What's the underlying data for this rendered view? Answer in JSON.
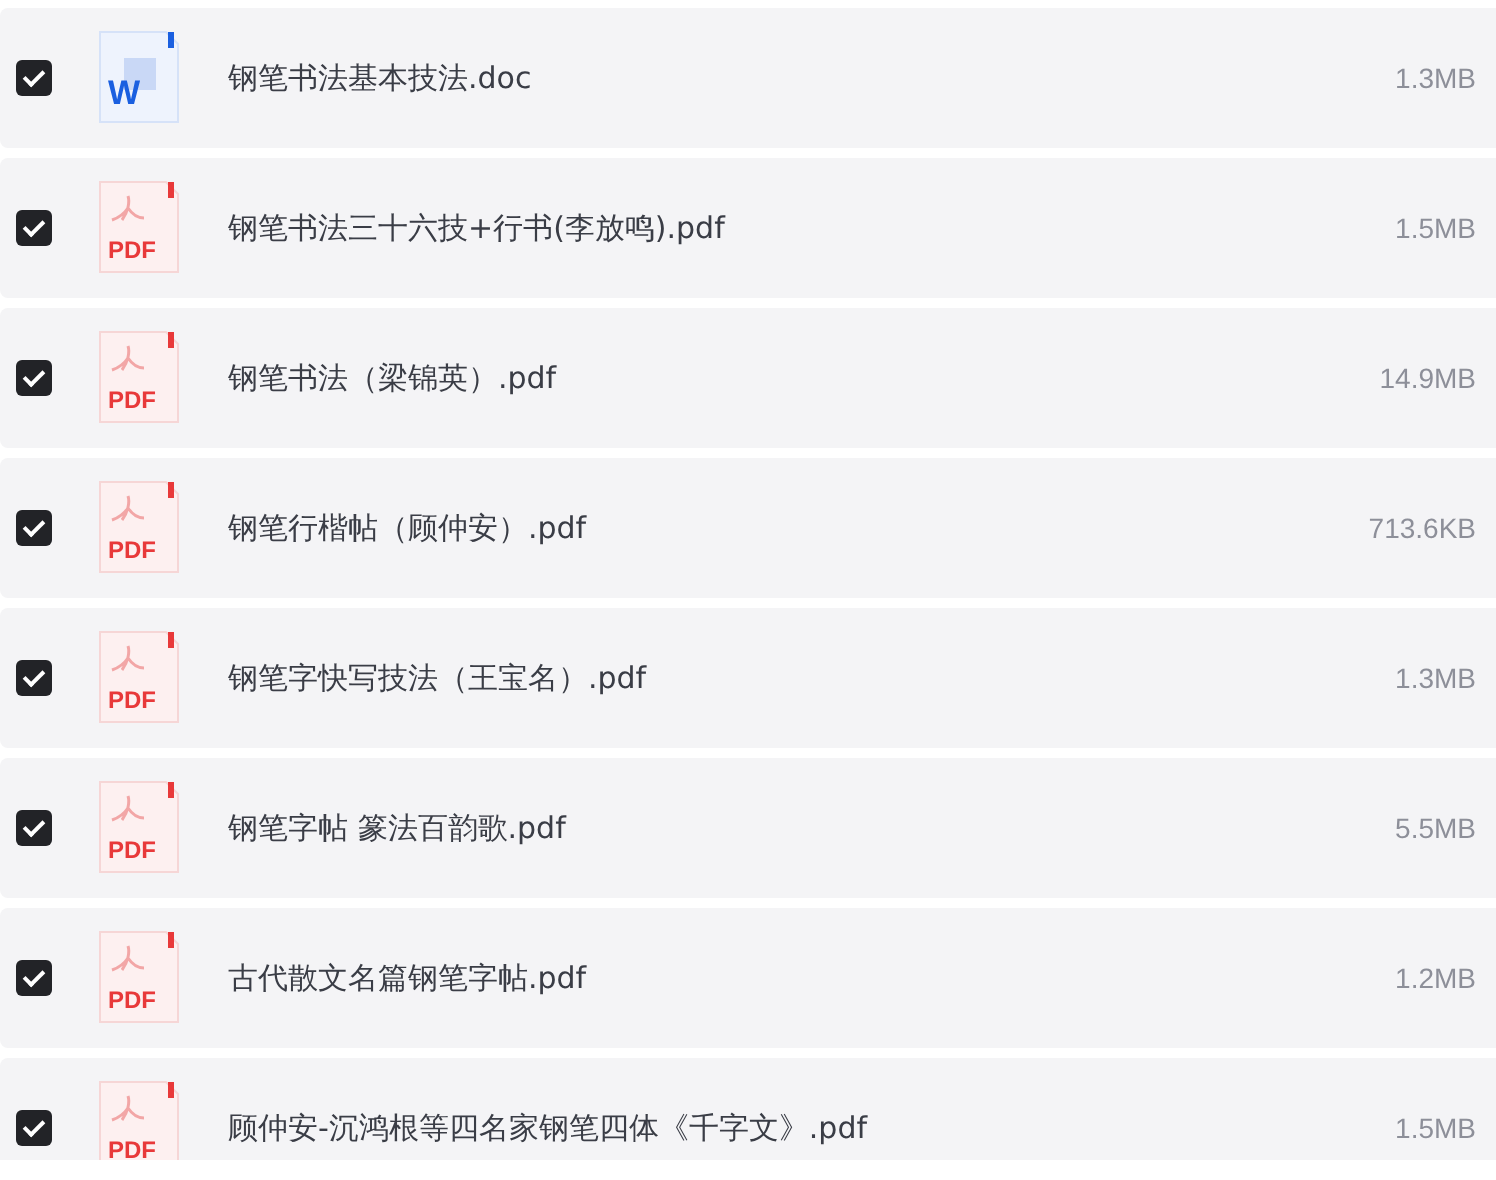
{
  "files": [
    {
      "kind": "doc",
      "icon_label": "W",
      "name": "钢笔书法基本技法.doc",
      "size": "1.3MB",
      "checked": true
    },
    {
      "kind": "pdf",
      "icon_label": "PDF",
      "name": "钢笔书法三十六技+行书(李放鸣).pdf",
      "size": "1.5MB",
      "checked": true
    },
    {
      "kind": "pdf",
      "icon_label": "PDF",
      "name": "钢笔书法（梁锦英）.pdf",
      "size": "14.9MB",
      "checked": true
    },
    {
      "kind": "pdf",
      "icon_label": "PDF",
      "name": "钢笔行楷帖（顾仲安）.pdf",
      "size": "713.6KB",
      "checked": true
    },
    {
      "kind": "pdf",
      "icon_label": "PDF",
      "name": "钢笔字快写技法（王宝名）.pdf",
      "size": "1.3MB",
      "checked": true
    },
    {
      "kind": "pdf",
      "icon_label": "PDF",
      "name": "钢笔字帖 篆法百韵歌.pdf",
      "size": "5.5MB",
      "checked": true
    },
    {
      "kind": "pdf",
      "icon_label": "PDF",
      "name": "古代散文名篇钢笔字帖.pdf",
      "size": "1.2MB",
      "checked": true
    },
    {
      "kind": "pdf",
      "icon_label": "PDF",
      "name": "顾仲安-沉鸿根等四名家钢笔四体《千字文》.pdf",
      "size": "1.5MB",
      "checked": true
    }
  ]
}
